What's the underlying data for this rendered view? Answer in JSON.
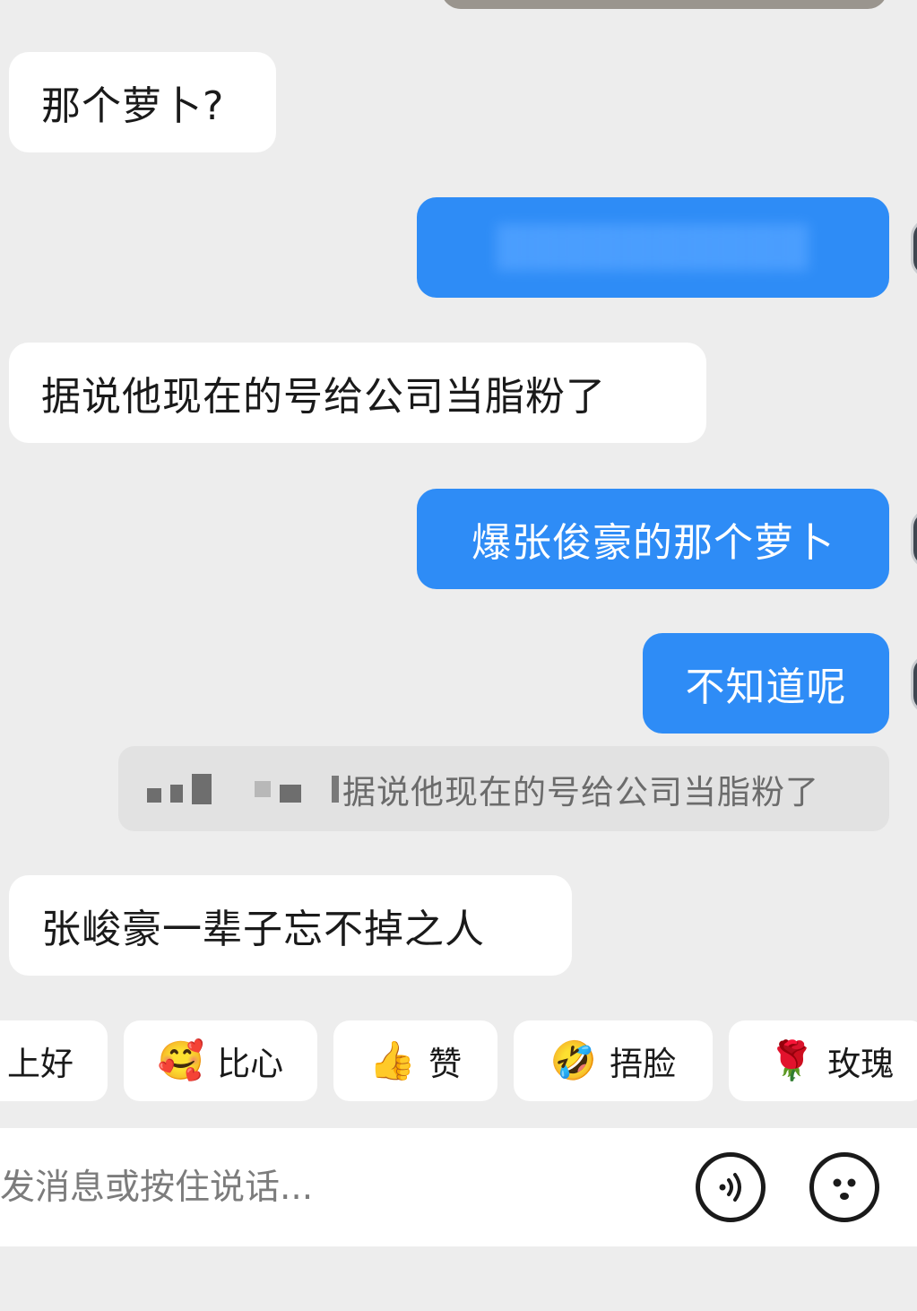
{
  "messages": [
    {
      "side": "in",
      "text": "那个萝卜?"
    },
    {
      "side": "out",
      "text": "██████████",
      "blurred": true
    },
    {
      "side": "in",
      "text": "据说他现在的号给公司当脂粉了"
    },
    {
      "side": "out",
      "text": "爆张俊豪的那个萝卜"
    },
    {
      "side": "out",
      "text": "不知道呢"
    },
    {
      "side": "in",
      "text": "张峻豪一辈子忘不掉之人"
    }
  ],
  "quote": {
    "text": "据说他现在的号给公司当脂粉了"
  },
  "quick_replies": [
    {
      "label": "上好",
      "emoji": ""
    },
    {
      "label": "比心",
      "emoji": "🥰"
    },
    {
      "label": "赞",
      "emoji": "👍"
    },
    {
      "label": "捂脸",
      "emoji": "🤣"
    },
    {
      "label": "玫瑰",
      "emoji": "🌹"
    }
  ],
  "input": {
    "placeholder": "发消息或按住说话..."
  },
  "icons": {
    "voice": "voice-wave-icon",
    "emoji": "emoji-face-icon"
  },
  "colors": {
    "outgoing_bubble": "#2e8cf6",
    "incoming_bubble": "#ffffff",
    "background": "#ededed"
  }
}
